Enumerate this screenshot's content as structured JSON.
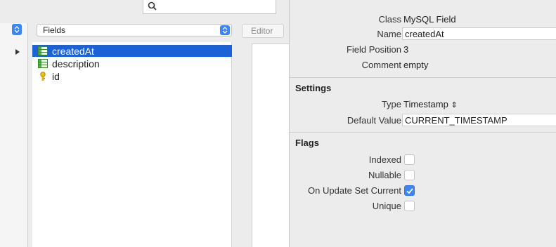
{
  "search": {
    "placeholder": ""
  },
  "fields_panel": {
    "header_label": "Fields",
    "items": [
      {
        "name": "createdAt",
        "icon": "field-icon",
        "selected": true
      },
      {
        "name": "description",
        "icon": "field-icon",
        "selected": false
      },
      {
        "name": "id",
        "icon": "key-icon",
        "selected": false
      }
    ]
  },
  "editor": {
    "button_label": "Editor"
  },
  "inspector": {
    "class_label": "Class",
    "class_value": "MySQL Field",
    "name_label": "Name",
    "name_value": "createdAt",
    "position_label": "Field Position",
    "position_value": "3",
    "comment_label": "Comment",
    "comment_value": "empty",
    "settings_title": "Settings",
    "type_label": "Type",
    "type_value": "Timestamp",
    "default_label": "Default Value",
    "default_value": "CURRENT_TIMESTAMP",
    "flags_title": "Flags",
    "flags": [
      {
        "label": "Indexed",
        "checked": false
      },
      {
        "label": "Nullable",
        "checked": false
      },
      {
        "label": "On Update Set Current",
        "checked": true
      },
      {
        "label": "Unique",
        "checked": false
      }
    ]
  },
  "colors": {
    "accent": "#3b86f7",
    "selection": "#1a62d6"
  }
}
